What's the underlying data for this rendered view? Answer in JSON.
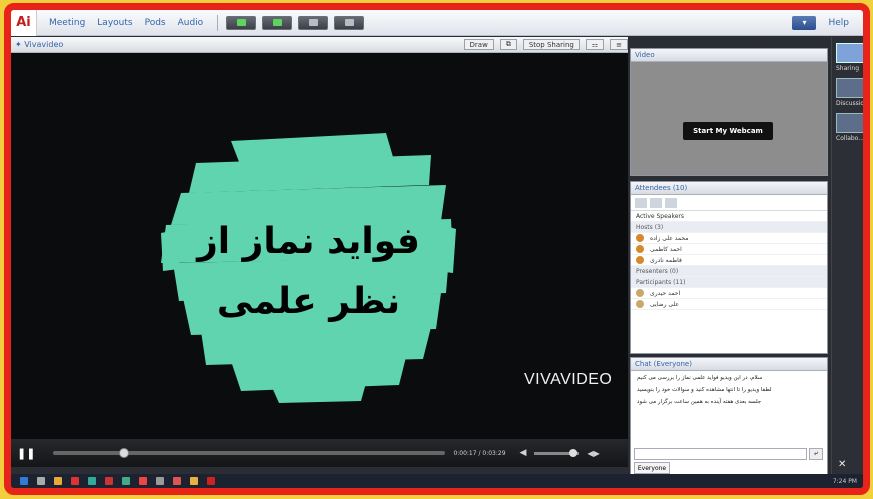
{
  "menubar": {
    "logo": "Ai",
    "items": [
      "Meeting",
      "Layouts",
      "Pods",
      "Audio"
    ],
    "help": "Help",
    "status": "▾"
  },
  "share_pod": {
    "title": "✦ Vivavideo",
    "buttons": [
      "Draw",
      "⧉",
      "Stop Sharing",
      "⚏",
      "≡"
    ],
    "slide_title_line1": "فواید نماز از",
    "slide_title_line2": "نظر علمی",
    "watermark": "VIVAVIDEO",
    "player": {
      "pause": "❚❚",
      "time": "0:00:17 / 0:03:29",
      "volume_icon": "◀",
      "fullscreen": "◀▶",
      "progress": 0.18,
      "volume": 0.85
    }
  },
  "video_pod": {
    "title": "Video",
    "webcam_button": "Start My Webcam"
  },
  "attendees_pod": {
    "title": "Attendees (10)",
    "sort_label": "Active Speakers",
    "hosts_group": "Hosts (3)",
    "hosts": [
      "محمد علی زاده",
      "احمد کاظمی",
      "فاطمه نادری"
    ],
    "presenters_group": "Presenters (0)",
    "participants_group": "Participants (11)",
    "participants": [
      "احمد حیدری",
      "علی رضایی"
    ]
  },
  "chat_pod": {
    "title": "Chat (Everyone)",
    "messages": [
      "سلام، در این ویدیو فواید علمی نماز را بررسی می کنیم",
      "لطفا ویدیو را تا انتها مشاهده کنید و سوالات خود را بنویسید",
      "جلسه بعدی هفته آینده به همین ساعت برگزار می شود"
    ],
    "send": "⤶",
    "tab": "Everyone"
  },
  "layouts": {
    "items": [
      "Sharing",
      "Discussion",
      "Collabo..."
    ],
    "bottom": "✕"
  },
  "taskbar": {
    "tray": "7:24 PM"
  },
  "colors": {
    "frame": "#e8231a",
    "background": "#f2cf3c",
    "paint": "#5fd4ae"
  }
}
